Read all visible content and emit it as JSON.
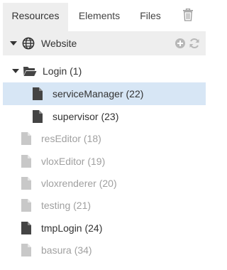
{
  "tabs": {
    "resources": "Resources",
    "elements": "Elements",
    "files": "Files"
  },
  "tree": {
    "root": {
      "label": "Website"
    },
    "folder": {
      "label": "Login (1)"
    },
    "children": [
      {
        "label": "serviceManager (22)"
      },
      {
        "label": "supervisor (23)"
      }
    ],
    "items": [
      {
        "label": "resEditor (18)"
      },
      {
        "label": "vloxEditor (19)"
      },
      {
        "label": "vloxrenderer (20)"
      },
      {
        "label": "testing (21)"
      },
      {
        "label": "tmpLogin (24)"
      },
      {
        "label": "basura (34)"
      }
    ]
  },
  "colors": {
    "selected_row": "#d7e6f5",
    "active_tab": "#eeeeee",
    "muted_text": "#a0a0a0",
    "dark_icon": "#444444",
    "muted_icon": "#c8c8c8"
  }
}
